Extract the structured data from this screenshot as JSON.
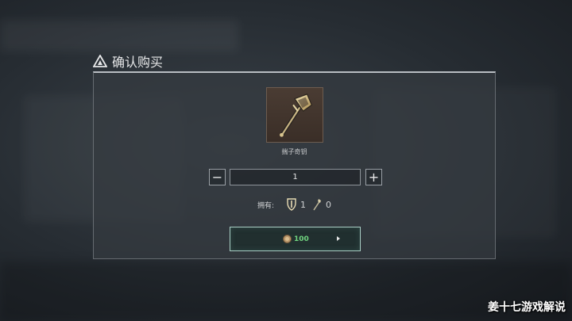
{
  "dialog": {
    "title": "确认购买",
    "title_icon": "warning-triangle-icon"
  },
  "item": {
    "name": "揣子奇钥",
    "icon": "hammer-key-icon"
  },
  "quantity": {
    "value": "1",
    "minus_label": "−",
    "plus_label": "+"
  },
  "owned": {
    "label": "拥有:",
    "items": [
      {
        "icon": "shield-emblem-icon",
        "count": "1"
      },
      {
        "icon": "wand-icon",
        "count": "0"
      }
    ]
  },
  "purchase": {
    "price": "100",
    "currency_icon": "coin-icon",
    "price_color": "#6fd47f"
  },
  "watermark": "姜十七游戏解说"
}
